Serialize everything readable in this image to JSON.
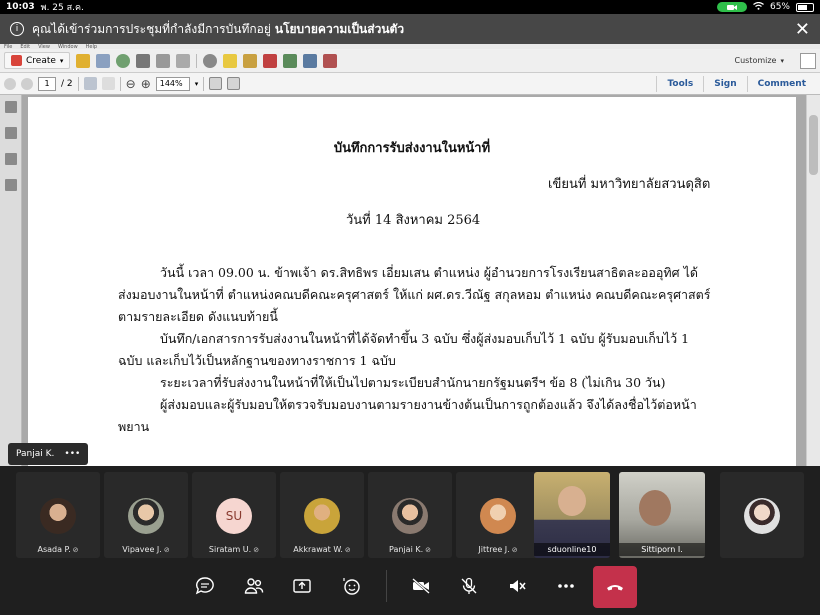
{
  "status_bar": {
    "time": "10:03",
    "date": "พ. 25 ส.ค.",
    "battery": "65%",
    "battery_level": 0.65,
    "wifi_icon": "wifi-icon",
    "camera_indicator_icon": "camera-active-icon"
  },
  "banner": {
    "message": "คุณได้เข้าร่วมการประชุมที่กำลังมีการบันทึกอยู่",
    "policy_link": "นโยบายความเป็นส่วนตัว",
    "close_icon": "close-icon"
  },
  "pdf_viewer": {
    "menu": [
      "File",
      "Edit",
      "View",
      "Window",
      "Help"
    ],
    "create_label": "Create",
    "customize_label": "Customize",
    "page_current": "1",
    "page_total": "/ 2",
    "zoom": "144%",
    "right_tabs": {
      "tools": "Tools",
      "sign": "Sign",
      "comment": "Comment"
    }
  },
  "document": {
    "title": "บันทึกการรับส่งงานในหน้าที่",
    "write_at": "เขียนที่ มหาวิทยาลัยสวนดุสิต",
    "date": "วันที่ 14  สิงหาคม  2564",
    "paragraph1_line1": "วันนี้ เวลา 09.00 น. ข้าพเจ้า ดร.สิทธิพร   เอี่ยมเสน ตำแหน่ง ผู้อำนวยการโรงเรียนสาธิตละอออุทิศ ได้",
    "paragraph1_line2": "ส่งมอบงานในหน้าที่ ตำแหน่งคณบดีคณะครุศาสตร์ ให้แก่ ผศ.ดร.วีณัฐ   สกุลหอม ตำแหน่ง คณบดีคณะครุศาสตร์",
    "paragraph1_line3": "ตามรายละเอียด ดังแนบท้ายนี้",
    "paragraph2_line1": "บันทึก/เอกสารการรับส่งงานในหน้าที่ได้จัดทำขึ้น 3 ฉบับ ซึ่งผู้ส่งมอบเก็บไว้ 1 ฉบับ ผู้รับมอบเก็บไว้ 1",
    "paragraph2_line2": "ฉบับ และเก็บไว้เป็นหลักฐานของทางราชการ 1 ฉบับ",
    "paragraph3": "ระยะเวลาที่รับส่งงานในหน้าที่ให้เป็นไปตามระเบียบสำนักนายกรัฐมนตรีฯ ข้อ 8 (ไม่เกิน 30 วัน)",
    "paragraph4_line1": "ผู้ส่งมอบและผู้รับมอบให้ตรวจรับมอบงานตามรายงานข้างต้นเป็นการถูกต้องแล้ว จึงได้ลงชื่อไว้ต่อหน้า",
    "paragraph4_line2": "พยาน"
  },
  "presenter": {
    "name": "Panjai K.",
    "more": "•••"
  },
  "participants": [
    {
      "name": "Asada P.",
      "avatar": "photo",
      "color": "#6a4a3a"
    },
    {
      "name": "Vipavee J.",
      "avatar": "photo",
      "color": "#8a8f7a"
    },
    {
      "name": "Siratam U.",
      "avatar": "initials",
      "initials": "SU",
      "color": "#f6d6d0"
    },
    {
      "name": "Akkrawat W.",
      "avatar": "photo",
      "color": "#c9a43a"
    },
    {
      "name": "Panjai K.",
      "avatar": "photo",
      "color": "#7a6a60"
    },
    {
      "name": "Jittree J.",
      "avatar": "photo",
      "color": "#d9a070"
    },
    {
      "name": "sduonline10",
      "avatar": "video",
      "color": "#b8a070"
    },
    {
      "name": "Sittiporn I.",
      "avatar": "video",
      "color": "#7a7a70"
    },
    {
      "name": "",
      "avatar": "photo",
      "color": "#d8d8d8"
    }
  ],
  "controls": {
    "chat_icon": "chat-icon",
    "participants_icon": "participants-icon",
    "share_icon": "share-screen-icon",
    "reactions_icon": "reactions-icon",
    "camera_off_icon": "camera-off-icon",
    "mic_off_icon": "mic-off-icon",
    "speaker_off_icon": "speaker-off-icon",
    "more_icon": "more-icon",
    "leave_icon": "hang-up-icon",
    "leave_color": "#c4314b"
  }
}
